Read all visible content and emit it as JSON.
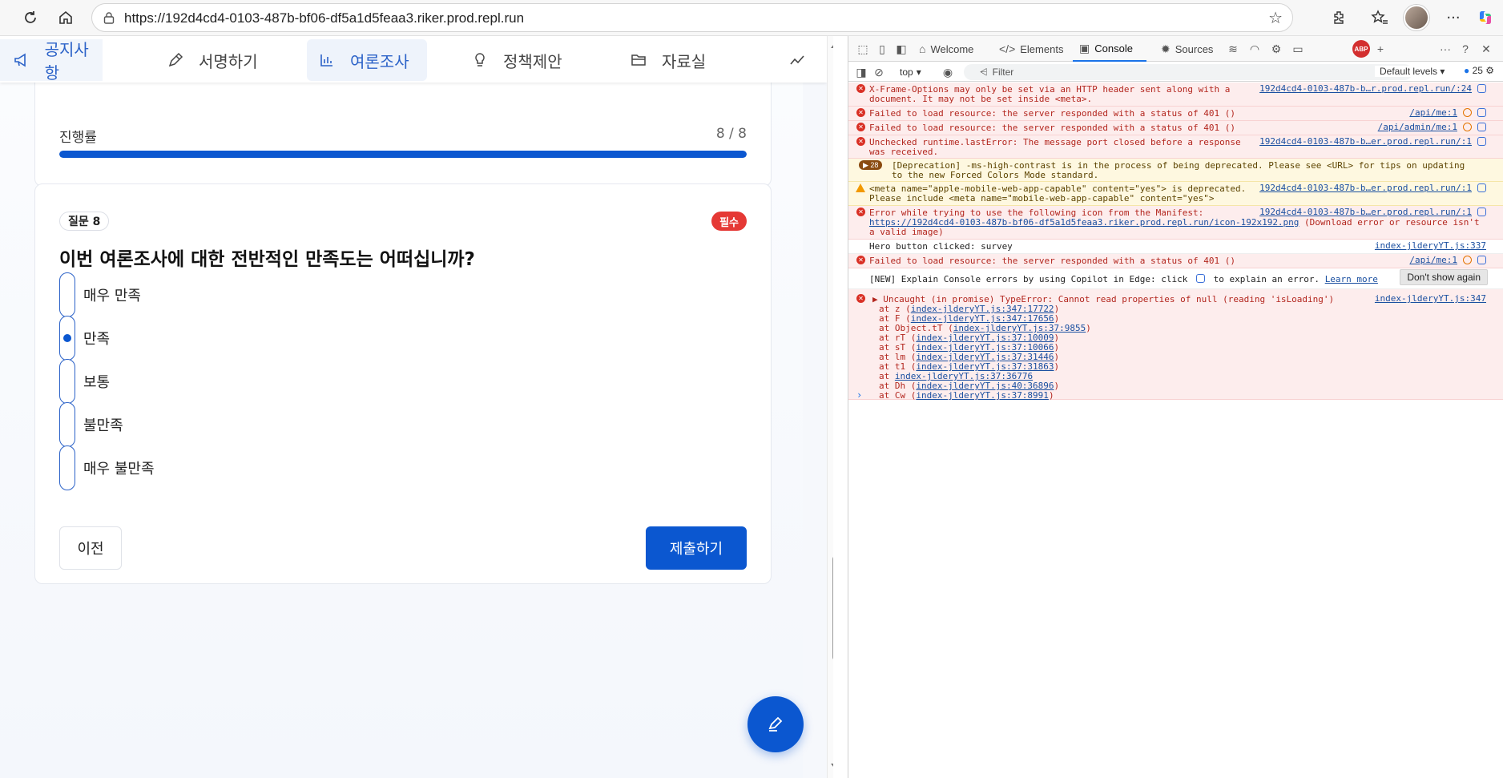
{
  "browser": {
    "url": "https://192d4cd4-0103-487b-bf06-df5a1d5feaa3.riker.prod.repl.run"
  },
  "nav": {
    "tabs": [
      {
        "label": "공지사항",
        "icon": "megaphone-icon"
      },
      {
        "label": "서명하기",
        "icon": "pen-icon"
      },
      {
        "label": "여론조사",
        "icon": "bar-chart-icon"
      },
      {
        "label": "정책제안",
        "icon": "lightbulb-icon"
      },
      {
        "label": "자료실",
        "icon": "folder-icon"
      }
    ],
    "active": "여론조사"
  },
  "progress": {
    "label": "진행률",
    "count": "8 / 8",
    "fraction": 1.0
  },
  "question": {
    "badge": "질문 8",
    "required": "필수",
    "title": "이번 여론조사에 대한 전반적인 만족도는 어떠십니까?",
    "options": [
      {
        "label": "매우 만족",
        "selected": false
      },
      {
        "label": "만족",
        "selected": true
      },
      {
        "label": "보통",
        "selected": false
      },
      {
        "label": "불만족",
        "selected": false
      },
      {
        "label": "매우 불만족",
        "selected": false
      }
    ],
    "prev_label": "이전",
    "submit_label": "제출하기"
  },
  "devtools": {
    "tabs": [
      "Welcome",
      "Elements",
      "Console",
      "Sources"
    ],
    "active_tab": "Console",
    "context": "top",
    "filter_placeholder": "Filter",
    "levels": "Default levels",
    "issue_count": "25",
    "abp_label": "ABP",
    "messages": [
      {
        "type": "error",
        "text": "X-Frame-Options may only be set via an HTTP header sent along with a\ndocument. It may not be set inside <meta>.",
        "source": "192d4cd4-0103-487b-b…r.prod.repl.run/:24"
      },
      {
        "type": "error",
        "text": "Failed to load resource: the server responded with a status of 401 ()",
        "source": "/api/me:1"
      },
      {
        "type": "error",
        "text": "Failed to load resource: the server responded with a status of 401 ()",
        "source": "/api/admin/me:1"
      },
      {
        "type": "error",
        "text": "Unchecked runtime.lastError: The message port closed before a response\nwas received.",
        "source": "192d4cd4-0103-487b-b…er.prod.repl.run/:1"
      },
      {
        "type": "warn",
        "repeat": "28",
        "text": "[Deprecation] -ms-high-contrast is in the process of being deprecated. Please see <URL> for tips on updating\nto the new Forced Colors Mode standard.",
        "source": ""
      },
      {
        "type": "warn",
        "text": "<meta name=\"apple-mobile-web-app-capable\" content=\"yes\"> is deprecated.\nPlease include <meta name=\"mobile-web-app-capable\" content=\"yes\">",
        "source": "192d4cd4-0103-487b-b…er.prod.repl.run/:1"
      },
      {
        "type": "error",
        "text": "Error while trying to use the following icon from the Manifest:",
        "link": "https://192d4cd4-0103-487b-bf06-df5a1d5feaa3.riker.prod.repl.run/icon-192x192.png",
        "text2": " (Download error or resource isn't\na valid image)",
        "source": "192d4cd4-0103-487b-b…er.prod.repl.run/:1"
      },
      {
        "type": "info",
        "text": "Hero button clicked: survey",
        "source": "index-jlderyYT.js:337"
      },
      {
        "type": "error",
        "text": "Failed to load resource: the server responded with a status of 401 ()",
        "source": "/api/me:1"
      },
      {
        "type": "info",
        "text": "[NEW] Explain Console errors by using Copilot in Edge: click",
        "text2": " to explain an error. ",
        "link": "Learn more",
        "button": "Don't show again"
      },
      {
        "type": "error",
        "text": "▶ Uncaught (in promise) TypeError: Cannot read properties of null (reading 'isLoading')",
        "source": "index-jlderyYT.js:347",
        "trace": [
          {
            "fn": "at z (",
            "loc": "index-jlderyYT.js:347:17722",
            "end": ")"
          },
          {
            "fn": "at F (",
            "loc": "index-jlderyYT.js:347:17656",
            "end": ")"
          },
          {
            "fn": "at Object.tT (",
            "loc": "index-jlderyYT.js:37:9855",
            "end": ")"
          },
          {
            "fn": "at rT (",
            "loc": "index-jlderyYT.js:37:10009",
            "end": ")"
          },
          {
            "fn": "at sT (",
            "loc": "index-jlderyYT.js:37:10066",
            "end": ")"
          },
          {
            "fn": "at lm (",
            "loc": "index-jlderyYT.js:37:31446",
            "end": ")"
          },
          {
            "fn": "at t1 (",
            "loc": "index-jlderyYT.js:37:31863",
            "end": ")"
          },
          {
            "fn": "at ",
            "loc": "index-jlderyYT.js:37:36776",
            "end": ""
          },
          {
            "fn": "at Dh (",
            "loc": "index-jlderyYT.js:40:36896",
            "end": ")"
          },
          {
            "fn": "at Cw (",
            "loc": "index-jlderyYT.js:37:8991",
            "end": ")"
          }
        ]
      }
    ]
  },
  "colors": {
    "accent": "#0b57d0",
    "required": "#e53935",
    "error_bg": "#fdeded",
    "warn_bg": "#fef8e0"
  }
}
